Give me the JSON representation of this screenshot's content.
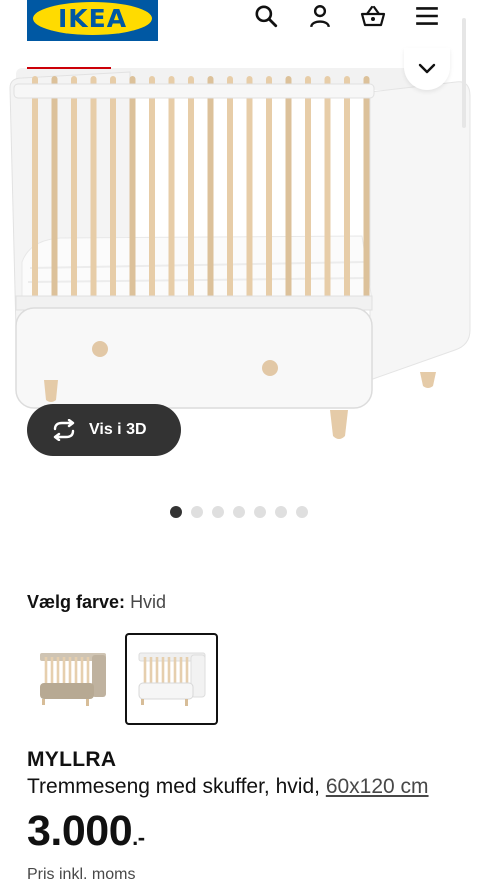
{
  "header": {
    "logo_text": "IKEA",
    "icons": [
      "search-icon",
      "user-icon",
      "basket-icon",
      "menu-icon"
    ]
  },
  "gallery": {
    "view_3d_label": "Vis i 3D",
    "image_count": 7,
    "active_index": 0
  },
  "color": {
    "label": "Vælg farve:",
    "value": "Hvid",
    "swatches": [
      {
        "name": "beige",
        "selected": false
      },
      {
        "name": "white",
        "selected": true
      }
    ]
  },
  "product": {
    "name": "MYLLRA",
    "description": "Tremmeseng med skuffer, hvid,",
    "size": "60x120 cm",
    "price_int": "3.000",
    "price_dec": ".-",
    "price_note": "Pris inkl. moms"
  },
  "colors": {
    "brand_blue": "#0058a3",
    "brand_yellow": "#ffdb00",
    "accent_red": "#cc0008",
    "dark": "#333333"
  }
}
